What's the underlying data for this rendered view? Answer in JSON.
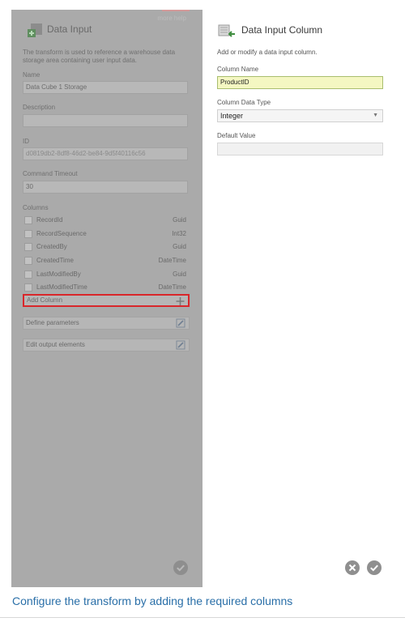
{
  "left_panel": {
    "title": "Data Input",
    "more_help": "more help",
    "description": "The transform is used to reference a warehouse data storage area containing user input data.",
    "name_label": "Name",
    "name_value": "Data Cube 1 Storage",
    "description_label": "Description",
    "description_value": "",
    "id_label": "ID",
    "id_value": "d0819db2-8df8-46d2-be84-9d5f40116c56",
    "timeout_label": "Command Timeout",
    "timeout_value": "30",
    "columns_label": "Columns",
    "columns": [
      {
        "name": "RecordId",
        "type": "Guid"
      },
      {
        "name": "RecordSequence",
        "type": "Int32"
      },
      {
        "name": "CreatedBy",
        "type": "Guid"
      },
      {
        "name": "CreatedTime",
        "type": "DateTime"
      },
      {
        "name": "LastModifiedBy",
        "type": "Guid"
      },
      {
        "name": "LastModifiedTime",
        "type": "DateTime"
      }
    ],
    "add_column": "Add Column",
    "define_parameters": "Define parameters",
    "edit_output": "Edit output elements"
  },
  "right_panel": {
    "title": "Data Input Column",
    "subtitle": "Add or modify a data input column.",
    "column_name_label": "Column Name",
    "column_name_value": "ProductID",
    "data_type_label": "Column Data Type",
    "data_type_value": "Integer",
    "default_label": "Default Value",
    "default_value": ""
  },
  "caption": "Configure the transform by adding the required columns",
  "colors": {
    "highlight": "#d9262a",
    "caption": "#2a6fa8",
    "disabled_panel": "#aaaaaa"
  },
  "icons": [
    "data-input-icon",
    "plus-icon",
    "edit-icon",
    "checkmark-icon",
    "data-input-column-icon",
    "cancel-icon",
    "dropdown-arrow-icon"
  ]
}
